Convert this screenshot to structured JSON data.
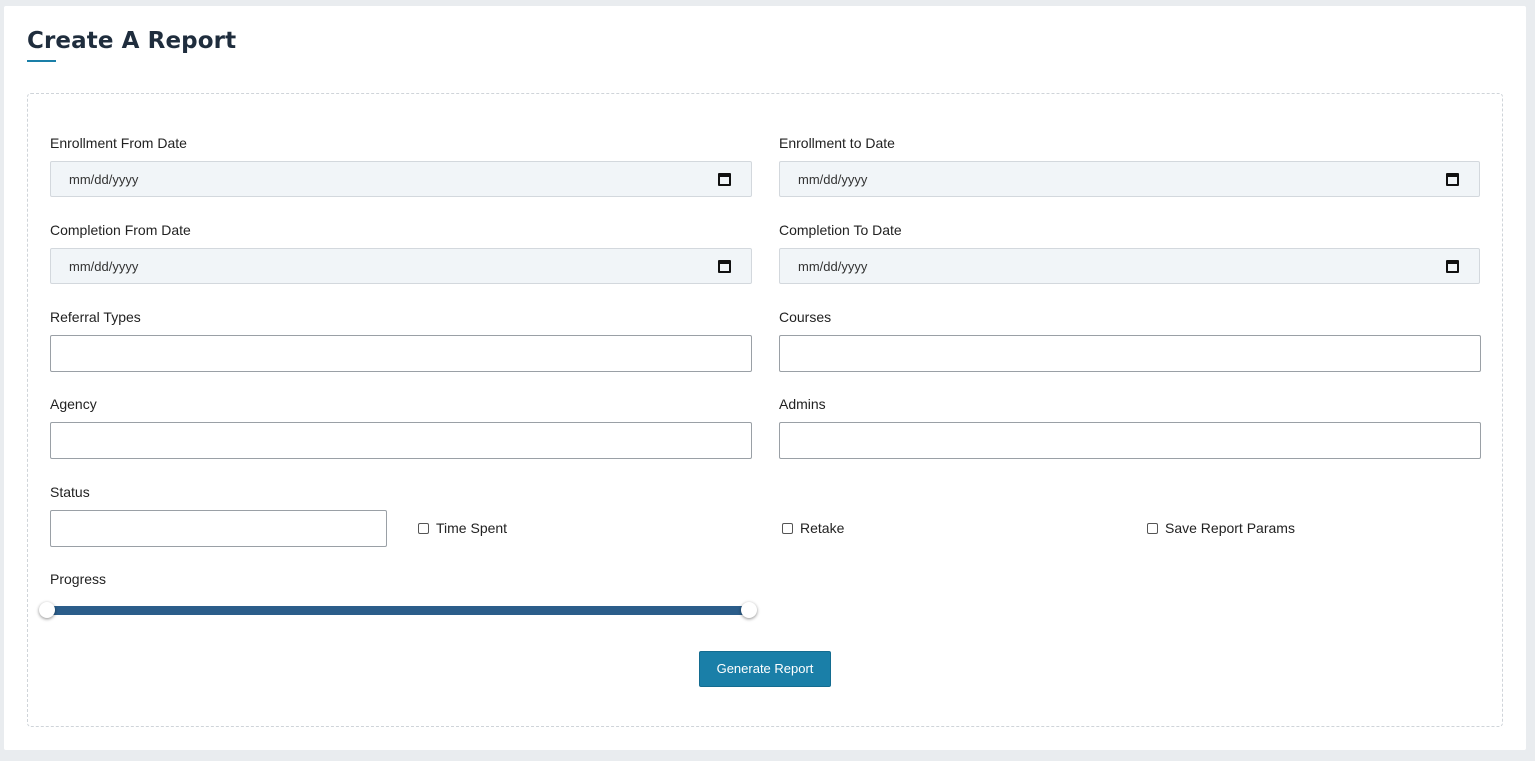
{
  "page": {
    "title": "Create A Report"
  },
  "fields": {
    "enrollment_from": {
      "label": "Enrollment From Date",
      "placeholder": "mm/dd/yyyy"
    },
    "enrollment_to": {
      "label": "Enrollment to Date",
      "placeholder": "mm/dd/yyyy"
    },
    "completion_from": {
      "label": "Completion From Date",
      "placeholder": "mm/dd/yyyy"
    },
    "completion_to": {
      "label": "Completion To Date",
      "placeholder": "mm/dd/yyyy"
    },
    "referral_types": {
      "label": "Referral Types",
      "value": ""
    },
    "courses": {
      "label": "Courses",
      "value": ""
    },
    "agency": {
      "label": "Agency",
      "value": ""
    },
    "admins": {
      "label": "Admins",
      "value": ""
    },
    "status": {
      "label": "Status",
      "value": ""
    }
  },
  "checkboxes": {
    "time_spent": {
      "label": "Time Spent",
      "checked": false
    },
    "retake": {
      "label": "Retake",
      "checked": false
    },
    "save_params": {
      "label": "Save Report Params",
      "checked": false
    }
  },
  "progress": {
    "label": "Progress",
    "range_min_fraction": 0,
    "range_max_fraction": 1
  },
  "actions": {
    "generate_label": "Generate Report"
  },
  "icons": {
    "date_picker": "calendar-icon"
  },
  "colors": {
    "primary": "#1a7fa8",
    "slider": "#2b5d8a",
    "title": "#1f2d3d",
    "date_field_bg": "#f1f5f8"
  }
}
